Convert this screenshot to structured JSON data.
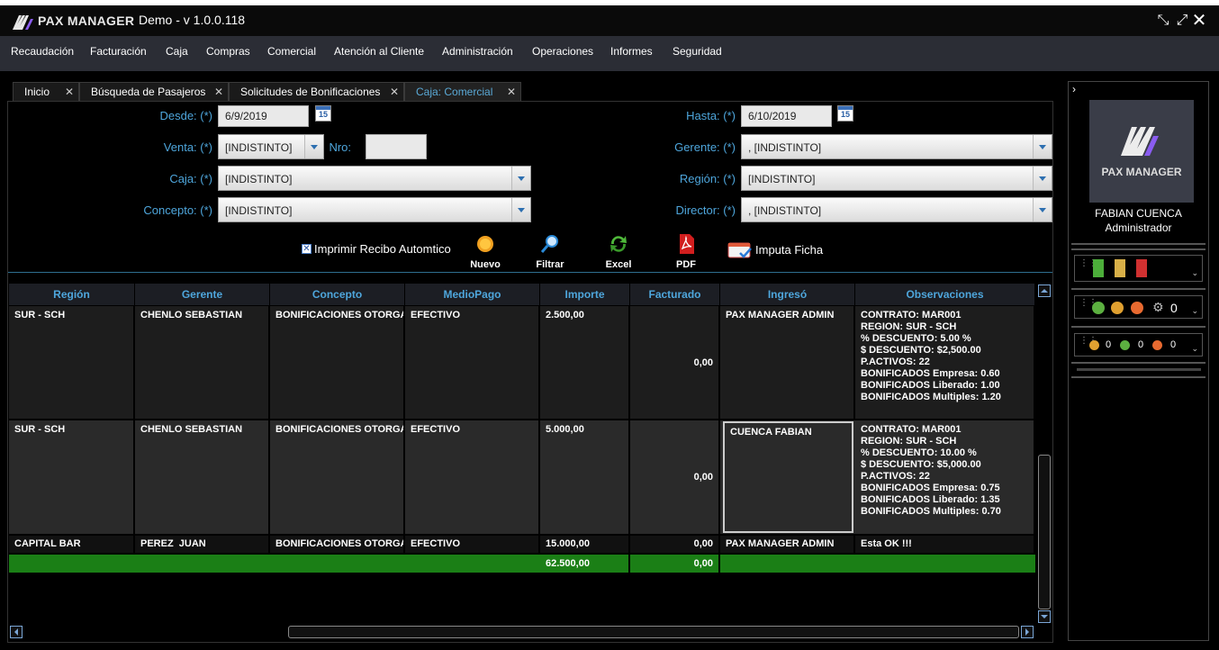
{
  "app": {
    "logo_text": "PAX MANAGER",
    "title": "Demo - v 1.0.0.118"
  },
  "menu": [
    "Recaudación",
    "Facturación",
    "Caja",
    "Compras",
    "Comercial",
    "Atención al Cliente",
    "Administración",
    "Operaciones",
    "Informes",
    "Seguridad"
  ],
  "tabs": [
    {
      "label": "Inicio",
      "active": false
    },
    {
      "label": "Búsqueda de Pasajeros",
      "active": false
    },
    {
      "label": "Solicitudes de Bonificaciones",
      "active": false
    },
    {
      "label": "Caja: Comercial",
      "active": true
    }
  ],
  "filters": {
    "desde_label": "Desde: (*)",
    "desde_value": "6/9/2019",
    "hasta_label": "Hasta: (*)",
    "hasta_value": "6/10/2019",
    "venta_label": "Venta: (*)",
    "venta_value": "[INDISTINTO]",
    "nro_label": "Nro:",
    "nro_value": "",
    "gerente_label": "Gerente: (*)",
    "gerente_value": ", [INDISTINTO]",
    "caja_label": "Caja: (*)",
    "caja_value": "[INDISTINTO]",
    "region_label": "Región: (*)",
    "region_value": "[INDISTINTO]",
    "concepto_label": "Concepto: (*)",
    "concepto_value": "[INDISTINTO]",
    "director_label": "Director: (*)",
    "director_value": ", [INDISTINTO]",
    "calendar_day": "15"
  },
  "toolbar": {
    "print_receipt_label": "Imprimir Recibo Automtico",
    "print_receipt_checked": true,
    "nuevo": "Nuevo",
    "filtrar": "Filtrar",
    "excel": "Excel",
    "pdf": "PDF",
    "imputa_ficha": "Imputa Ficha"
  },
  "grid": {
    "columns": [
      "Región",
      "Gerente",
      "Concepto",
      "MedioPago",
      "Importe",
      "Facturado",
      "Ingresó",
      "Observaciones"
    ],
    "rows": [
      {
        "region": "SUR - SCH",
        "gerente": "CHENLO SEBASTIAN",
        "concepto": "BONIFICACIONES OTORGADAS",
        "medio": "EFECTIVO",
        "importe": "2.500,00",
        "facturado": "0,00",
        "ingreso": "PAX MANAGER ADMIN",
        "obs": "CONTRATO: MAR001\nREGION: SUR - SCH\n% DESCUENTO: 5.00 %\n$ DESCUENTO: $2,500.00\nP.ACTIVOS: 22\nBONIFICADOS Empresa: 0.60\nBONIFICADOS Liberado: 1.00\nBONIFICADOS Multiples: 1.20"
      },
      {
        "region": "SUR - SCH",
        "gerente": "CHENLO SEBASTIAN",
        "concepto": "BONIFICACIONES OTORGADAS",
        "medio": "EFECTIVO",
        "importe": "5.000,00",
        "facturado": "0,00",
        "ingreso": "CUENCA FABIAN",
        "obs": "CONTRATO: MAR001\nREGION: SUR - SCH\n% DESCUENTO: 10.00 %\n$ DESCUENTO: $5,000.00\nP.ACTIVOS: 22\nBONIFICADOS Empresa: 0.75\nBONIFICADOS Liberado: 1.35\nBONIFICADOS Multiples: 0.70"
      },
      {
        "region": "CAPITAL BAR",
        "gerente": "PEREZ  JUAN",
        "concepto": "BONIFICACIONES OTORGADAS",
        "medio": "EFECTIVO",
        "importe": "15.000,00",
        "facturado": "0,00",
        "ingreso": "PAX MANAGER ADMIN",
        "obs": "Esta OK !!!"
      }
    ],
    "totals": {
      "importe": "62.500,00",
      "facturado": "0,00"
    }
  },
  "user_panel": {
    "logo_text": "PAX MANAGER",
    "name": "FABIAN CUENCA",
    "role": "Administrador",
    "counter_main": "0",
    "counter_a": "0",
    "counter_b": "0",
    "counter_c": "0"
  },
  "colors": {
    "accent": "#4ea6dc",
    "total_row": "#1b7f16",
    "menubar": "#2b2d35"
  }
}
